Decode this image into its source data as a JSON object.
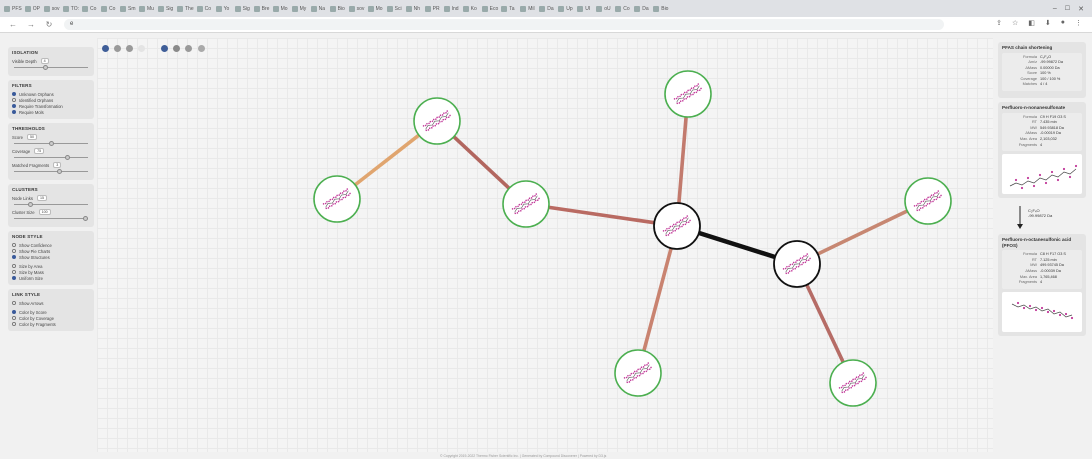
{
  "browser": {
    "tabs": [
      {
        "label": "PFS"
      },
      {
        "label": "OP"
      },
      {
        "label": "sov"
      },
      {
        "label": "TO:"
      },
      {
        "label": "Co"
      },
      {
        "label": "Co"
      },
      {
        "label": "Sm"
      },
      {
        "label": "Mu"
      },
      {
        "label": "Sig"
      },
      {
        "label": "The"
      },
      {
        "label": "Co"
      },
      {
        "label": "Yo"
      },
      {
        "label": "Sig"
      },
      {
        "label": "Bre"
      },
      {
        "label": "Mo"
      },
      {
        "label": "My"
      },
      {
        "label": "Na"
      },
      {
        "label": "Bio"
      },
      {
        "label": "sov"
      },
      {
        "label": "Mo"
      },
      {
        "label": "Sci"
      },
      {
        "label": "Nh"
      },
      {
        "label": "PR"
      },
      {
        "label": "Ind"
      },
      {
        "label": "Ko"
      },
      {
        "label": "Eco"
      },
      {
        "label": "Ta"
      },
      {
        "label": "Mil"
      },
      {
        "label": "Da"
      },
      {
        "label": "Up"
      },
      {
        "label": "UI"
      },
      {
        "label": "oU"
      },
      {
        "label": "Co"
      },
      {
        "label": "Da"
      },
      {
        "label": "Bio"
      }
    ],
    "address": "e"
  },
  "left_panel": {
    "isolation": {
      "title": "ISOLATION",
      "visible_depth_label": "Visible Depth",
      "visible_depth_value": "4",
      "visible_depth_level": 0.42
    },
    "filters": {
      "title": "FILTERS",
      "items": [
        {
          "label": "Unknown Orphans",
          "checked": true
        },
        {
          "label": "Identified Orphans",
          "checked": false
        },
        {
          "label": "Require Transformation",
          "checked": true
        },
        {
          "label": "Require Mols",
          "checked": true
        }
      ]
    },
    "thresholds": {
      "title": "THRESHOLDS",
      "items": [
        {
          "label": "Score",
          "value": "50",
          "level": 0.5
        },
        {
          "label": "Coverage",
          "value": "75",
          "level": 0.72
        },
        {
          "label": "Matched Fragments",
          "value": "3",
          "level": 0.62
        }
      ]
    },
    "clusters": {
      "title": "CLUSTERS",
      "items": [
        {
          "label": "Node Links",
          "value": "15",
          "level": 0.22
        },
        {
          "label": "Cluster Size",
          "value": "100",
          "level": 0.97
        }
      ]
    },
    "node_style": {
      "title": "NODE STYLE",
      "group1": [
        {
          "label": "Show Confidence",
          "checked": false
        },
        {
          "label": "Show Pie Charts",
          "checked": false
        },
        {
          "label": "Show Structures",
          "checked": true
        }
      ],
      "group2": [
        {
          "label": "Size by Area",
          "checked": false
        },
        {
          "label": "Size by Mass",
          "checked": false
        },
        {
          "label": "Uniform Size",
          "checked": true
        }
      ]
    },
    "link_style": {
      "title": "LINK STYLE",
      "group1": [
        {
          "label": "Show Arrows",
          "checked": false
        }
      ],
      "group2": [
        {
          "label": "Color by Score",
          "checked": true
        },
        {
          "label": "Color by Coverage",
          "checked": false
        },
        {
          "label": "Color by Fragments",
          "checked": false
        }
      ]
    }
  },
  "right_panel": {
    "summary": {
      "title": "PFAS chain shortening",
      "rows": [
        {
          "k": "Formula",
          "v": "C₂F₄O"
        },
        {
          "k": "Δm/z",
          "v": "-99.99872 Da"
        },
        {
          "k": "ΔMass",
          "v": "0.00000 Da"
        },
        {
          "k": "Score",
          "v": "100 %"
        },
        {
          "k": "Coverage",
          "v": "100 / 100 %"
        },
        {
          "k": "Matches",
          "v": "4 / 4"
        }
      ]
    },
    "compound_a": {
      "title": "Perfluoro-n-nonanesulfonate",
      "rows": [
        {
          "k": "Formula",
          "v": "C9 H F19 O3 S"
        },
        {
          "k": "RT",
          "v": "7.435 min"
        },
        {
          "k": "MW",
          "v": "549.93818 Da"
        },
        {
          "k": "ΔMass",
          "v": "-0.00019 Da"
        },
        {
          "k": "Max. Area",
          "v": "2,103,032"
        },
        {
          "k": "Fragments",
          "v": "4"
        }
      ]
    },
    "transition": {
      "line1": "C₂F₄O",
      "line2": "-99.99872 Da"
    },
    "compound_b": {
      "title": "Perfluoro-n-octanesulfonic acid (PFOS)",
      "rows": [
        {
          "k": "Formula",
          "v": "C8 H F17 O3 S"
        },
        {
          "k": "RT",
          "v": "7.125 min"
        },
        {
          "k": "MW",
          "v": "499.93745 Da"
        },
        {
          "k": "ΔMass",
          "v": "-0.00039 Da"
        },
        {
          "k": "Max. Area",
          "v": "1,765,468"
        },
        {
          "k": "Fragments",
          "v": "4"
        }
      ]
    }
  },
  "footer": {
    "text": "© Copyright 2019-2022 Thermo Fisher Scientific Inc. | Generated by Compound Discoverer | Powered by D3.js"
  }
}
